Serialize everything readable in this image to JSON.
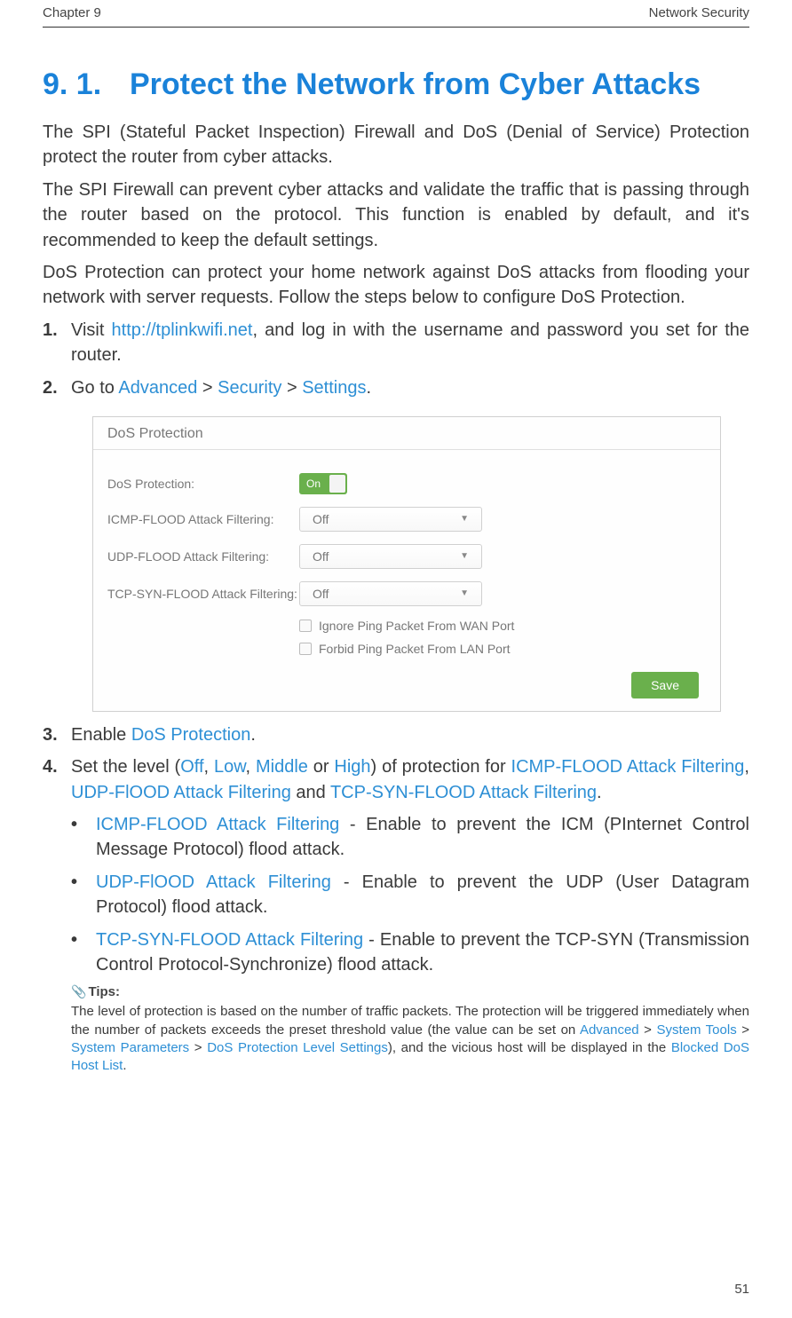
{
  "topbar": {
    "chapter": "Chapter 9",
    "section": "Network Security"
  },
  "heading": {
    "num": "9. 1.",
    "title": "Protect the Network from Cyber Attacks"
  },
  "paras": {
    "p1": "The SPI (Stateful Packet Inspection) Firewall and DoS (Denial of Service) Protection protect the router from cyber attacks.",
    "p2": "The SPI Firewall can prevent cyber attacks and validate the traffic that is passing through the router based on the protocol. This function is enabled by default, and it's recommended to keep the default settings.",
    "p3": "DoS Protection can protect your home network against DoS attacks from flooding your network with server requests. Follow the steps below to configure DoS Protection."
  },
  "steps": {
    "s1": {
      "num": "1.",
      "pre": "Visit ",
      "link": "http://tplinkwifi.net",
      "post": ", and log in with the username and password you set for the router."
    },
    "s2": {
      "num": "2.",
      "pre": "Go to ",
      "a": "Advanced",
      "b": "Security",
      "c": "Settings",
      "gt": " > ",
      "dot": "."
    },
    "s3": {
      "num": "3.",
      "pre": "Enable ",
      "term": "DoS Protection",
      "dot": "."
    },
    "s4": {
      "num": "4.",
      "t0": "Set the level (",
      "off": "Off",
      "c1": ", ",
      "low": "Low",
      "c2": ", ",
      "mid": "Middle",
      "c3": " or ",
      "high": "High",
      "t1": ") of protection for ",
      "f1": "ICMP-FLOOD Attack Filtering",
      "c4": ", ",
      "f2": "UDP-FlOOD Attack Filtering",
      "c5": " and ",
      "f3": "TCP-SYN-FLOOD Attack Filtering",
      "dot": "."
    }
  },
  "bullets": {
    "b1": {
      "term": "ICMP-FLOOD Attack Filtering",
      "text": " - Enable to prevent the ICM (PInternet Control Message Protocol) flood attack."
    },
    "b2": {
      "term": "UDP-FlOOD Attack Filtering",
      "text": " - Enable to prevent the UDP (User Datagram Protocol) flood attack."
    },
    "b3": {
      "term": "TCP-SYN-FLOOD Attack Filtering",
      "text": " - Enable to prevent the TCP-SYN (Transmission Control Protocol-Synchronize) flood attack."
    }
  },
  "screenshot": {
    "header": "DoS Protection",
    "row_label": "DoS Protection:",
    "toggle_text": "On",
    "rows": {
      "icmp_label": "ICMP-FLOOD Attack Filtering:",
      "udp_label": "UDP-FLOOD Attack Filtering:",
      "tcp_label": "TCP-SYN-FLOOD Attack Filtering:",
      "value_off": "Off"
    },
    "check1": "Ignore Ping Packet From WAN Port",
    "check2": "Forbid Ping Packet From LAN Port",
    "save": "Save"
  },
  "tips": {
    "label": "Tips:",
    "t0": "The level of protection is based on the number of traffic packets. The protection will be triggered immediately when the number of packets exceeds the preset threshold value (the value can be set on ",
    "a": "Advanced",
    "gt1": " > ",
    "b": "System Tools",
    "gt2": " > ",
    "c": "System Parameters",
    "gt3": " > ",
    "d": "DoS Protection Level Settings",
    "t1": "), and the vicious host will be displayed in the ",
    "e": "Blocked DoS Host List",
    "dot": "."
  },
  "page_number": "51"
}
